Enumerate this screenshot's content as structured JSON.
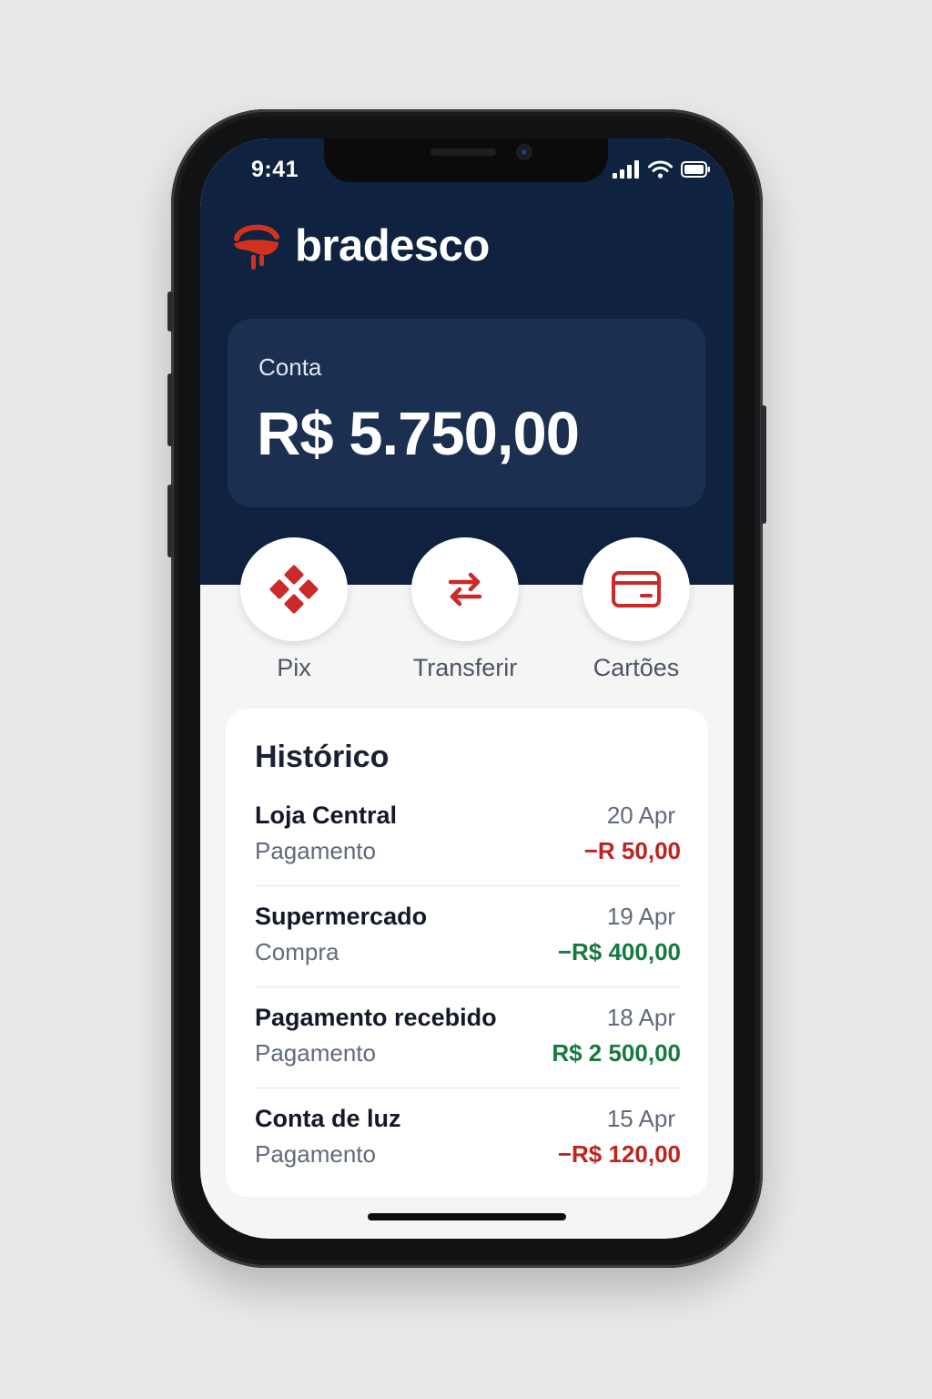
{
  "status_bar": {
    "time": "9:41"
  },
  "brand": {
    "name": "bradesco",
    "color": "#cc2a2a"
  },
  "account": {
    "label": "Conta",
    "balance": "R$ 5.750,00"
  },
  "actions": [
    {
      "label": "Pix",
      "icon": "pix-icon"
    },
    {
      "label": "Transferir",
      "icon": "transfer-arrows-icon"
    },
    {
      "label": "Cartões",
      "icon": "credit-card-icon"
    }
  ],
  "history": {
    "title": "Histórico",
    "items": [
      {
        "name": "Loja Central",
        "type": "Pagamento",
        "date": "20 Apr",
        "amount": "−R 50,00",
        "amount_color": "#c0221f"
      },
      {
        "name": "Supermercado",
        "type": "Compra",
        "date": "19 Apr",
        "amount": "−R$ 400,00",
        "amount_color": "#167a3f"
      },
      {
        "name": "Pagamento recebido",
        "type": "Pagamento",
        "date": "18 Apr",
        "amount": "R$ 2 500,00",
        "amount_color": "#167a3f"
      },
      {
        "name": "Conta de luz",
        "type": "Pagamento",
        "date": "15 Apr",
        "amount": "−R$ 120,00",
        "amount_color": "#c0221f"
      }
    ]
  },
  "colors": {
    "header_bg": "#0f2240",
    "card_bg": "#1b3050",
    "accent": "#cc2a2a"
  }
}
